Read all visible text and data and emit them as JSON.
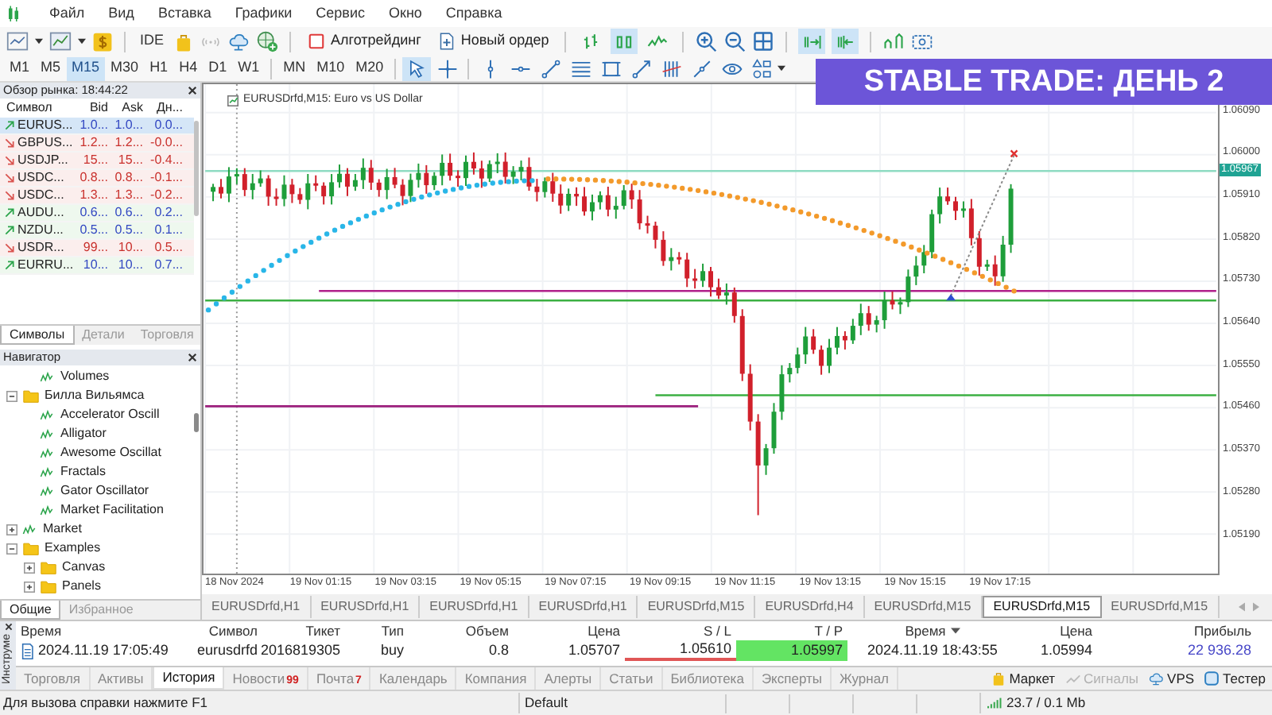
{
  "menu": {
    "items": [
      "Файл",
      "Вид",
      "Вставка",
      "Графики",
      "Сервис",
      "Окно",
      "Справка"
    ]
  },
  "toolbar": {
    "ide_label": "IDE",
    "algotrading_label": "Алготрейдинг",
    "new_order_label": "Новый ордер",
    "chart_modes": [
      {
        "selected": false
      },
      {
        "selected": true
      },
      {
        "selected": false
      }
    ],
    "scroll_modes": [
      {
        "selected": true
      },
      {
        "selected": true
      }
    ]
  },
  "timeframes": [
    {
      "label": "M1",
      "selected": false
    },
    {
      "label": "M5",
      "selected": false
    },
    {
      "label": "M15",
      "selected": true
    },
    {
      "label": "M30",
      "selected": false
    },
    {
      "label": "H1",
      "selected": false
    },
    {
      "label": "H4",
      "selected": false
    },
    {
      "label": "D1",
      "selected": false
    },
    {
      "label": "W1",
      "selected": false
    },
    {
      "label": "MN",
      "selected": false
    },
    {
      "label": "M10",
      "selected": false
    },
    {
      "label": "M20",
      "selected": false
    }
  ],
  "drawing_tools": [
    {
      "selected": true
    },
    {
      "selected": false
    },
    {
      "selected": false
    },
    {
      "selected": false
    },
    {
      "selected": false
    },
    {
      "selected": false
    },
    {
      "selected": false
    },
    {
      "selected": false
    },
    {
      "selected": false
    },
    {
      "selected": false
    },
    {
      "selected": false
    },
    {
      "selected": false
    }
  ],
  "banner": {
    "text": "STABLE TRADE: **ДЕНЬ 2**"
  },
  "market_watch": {
    "title": "Обзор рынка: 18:44:22",
    "columns": [
      "Символ",
      "Bid",
      "Ask",
      "Дн..."
    ],
    "rows": [
      {
        "symbol": "EURUS...",
        "bid": "1.0...",
        "ask": "1.0...",
        "change": "0.0...",
        "rising": true,
        "selected": true
      },
      {
        "symbol": "GBPUS...",
        "bid": "1.2...",
        "ask": "1.2...",
        "change": "-0.0...",
        "rising": false,
        "selected": false
      },
      {
        "symbol": "USDJP...",
        "bid": "15...",
        "ask": "15...",
        "change": "-0.4...",
        "rising": false,
        "selected": false
      },
      {
        "symbol": "USDC...",
        "bid": "0.8...",
        "ask": "0.8...",
        "change": "-0.1...",
        "rising": false,
        "selected": false
      },
      {
        "symbol": "USDC...",
        "bid": "1.3...",
        "ask": "1.3...",
        "change": "-0.2...",
        "rising": false,
        "selected": false
      },
      {
        "symbol": "AUDU...",
        "bid": "0.6...",
        "ask": "0.6...",
        "change": "0.2...",
        "rising": true,
        "selected": false
      },
      {
        "symbol": "NZDU...",
        "bid": "0.5...",
        "ask": "0.5...",
        "change": "0.1...",
        "rising": true,
        "selected": false
      },
      {
        "symbol": "USDR...",
        "bid": "99...",
        "ask": "10...",
        "change": "0.5...",
        "rising": false,
        "selected": false
      },
      {
        "symbol": "EURRU...",
        "bid": "10...",
        "ask": "10...",
        "change": "0.7...",
        "rising": true,
        "selected": false
      }
    ],
    "tabs": [
      {
        "label": "Символы",
        "selected": true
      },
      {
        "label": "Детали",
        "selected": false
      },
      {
        "label": "Торговля",
        "selected": false
      }
    ]
  },
  "navigator": {
    "title": "Навигатор",
    "tree": [
      {
        "kind": "scrolled",
        "children": [
          {
            "kind": "indicator",
            "label": "Volumes"
          }
        ]
      },
      {
        "kind": "folder",
        "label": "Билла Вильямса",
        "expanded": true,
        "children": [
          {
            "kind": "indicator",
            "label": "Accelerator Oscill"
          },
          {
            "kind": "indicator",
            "label": "Alligator"
          },
          {
            "kind": "indicator",
            "label": "Awesome Oscillat"
          },
          {
            "kind": "indicator",
            "label": "Fractals"
          },
          {
            "kind": "indicator",
            "label": "Gator Oscillator"
          },
          {
            "kind": "indicator",
            "label": "Market Facilitation"
          }
        ]
      },
      {
        "kind": "indicator",
        "label": "Market",
        "expanded": false
      },
      {
        "kind": "folder",
        "label": "Examples",
        "expanded": true,
        "children": [
          {
            "kind": "folder",
            "label": "Canvas",
            "expanded": false
          },
          {
            "kind": "folder",
            "label": "Panels",
            "expanded": false
          }
        ]
      }
    ],
    "tabs": [
      {
        "label": "Общие",
        "selected": true
      },
      {
        "label": "Избранное",
        "selected": false
      }
    ]
  },
  "chart": {
    "title": "EURUSDrfd,M15:  Euro vs US Dollar",
    "current_price": "1.05967",
    "price_labels": [
      "1.06090",
      "1.06000",
      "1.05910",
      "1.05820",
      "1.05730",
      "1.05640",
      "1.05550",
      "1.05460",
      "1.05370",
      "1.05280",
      "1.05190"
    ],
    "time_labels": [
      "18 Nov 2024",
      "19 Nov 01:15",
      "19 Nov 03:15",
      "19 Nov 05:15",
      "19 Nov 07:15",
      "19 Nov 09:15",
      "19 Nov 11:15",
      "19 Nov 13:15",
      "19 Nov 15:15",
      "19 Nov 17:15"
    ]
  },
  "chart_tabs": [
    {
      "label": "EURUSDrfd,H1",
      "selected": false
    },
    {
      "label": "EURUSDrfd,H1",
      "selected": false
    },
    {
      "label": "EURUSDrfd,H1",
      "selected": false
    },
    {
      "label": "EURUSDrfd,H1",
      "selected": false
    },
    {
      "label": "EURUSDrfd,M15",
      "selected": false
    },
    {
      "label": "EURUSDrfd,H4",
      "selected": false
    },
    {
      "label": "EURUSDrfd,M15",
      "selected": false
    },
    {
      "label": "EURUSDrfd,M15",
      "selected": true
    },
    {
      "label": "EURUSDrfd,M15",
      "selected": false
    }
  ],
  "toolbox": {
    "side_label": "Инструме",
    "columns": [
      {
        "label": "Время",
        "sorted": false
      },
      {
        "label": "Символ",
        "sorted": false
      },
      {
        "label": "Тикет",
        "sorted": false
      },
      {
        "label": "Тип",
        "sorted": false
      },
      {
        "label": "Объем",
        "sorted": false
      },
      {
        "label": "Цена",
        "sorted": false
      },
      {
        "label": "S / L",
        "sorted": false
      },
      {
        "label": "T / P",
        "sorted": false
      },
      {
        "label": "Время",
        "sorted": true
      },
      {
        "label": "Цена",
        "sorted": false
      },
      {
        "label": "Прибыль",
        "sorted": false
      }
    ],
    "rows": [
      {
        "cells": [
          {
            "text": "2024.11.19 17:05:49",
            "kind": "plain"
          },
          {
            "text": "eurusdrfd",
            "kind": "plain"
          },
          {
            "text": "2016819305",
            "kind": "plain"
          },
          {
            "text": "buy",
            "kind": "plain"
          },
          {
            "text": "0.8",
            "kind": "plain"
          },
          {
            "text": "1.05707",
            "kind": "plain"
          },
          {
            "text": "1.05610",
            "kind": "sl"
          },
          {
            "text": "1.05997",
            "kind": "tp"
          },
          {
            "text": "2024.11.19 18:43:55",
            "kind": "plain"
          },
          {
            "text": "1.05994",
            "kind": "plain"
          },
          {
            "text": "22 936.28",
            "kind": "profit"
          }
        ]
      }
    ],
    "tabs": [
      {
        "label": "Торговля",
        "selected": false
      },
      {
        "label": "Активы",
        "selected": false
      },
      {
        "label": "История",
        "selected": true
      },
      {
        "label": "Новости",
        "selected": false,
        "badge": "99"
      },
      {
        "label": "Почта",
        "selected": false,
        "badge": "7"
      },
      {
        "label": "Календарь",
        "selected": false
      },
      {
        "label": "Компания",
        "selected": false
      },
      {
        "label": "Алерты",
        "selected": false
      },
      {
        "label": "Статьи",
        "selected": false
      },
      {
        "label": "Библиотека",
        "selected": false
      },
      {
        "label": "Эксперты",
        "selected": false
      },
      {
        "label": "Журнал",
        "selected": false
      }
    ],
    "services": [
      {
        "label": "Маркет",
        "disabled": false
      },
      {
        "label": "Сигналы",
        "disabled": true
      },
      {
        "label": "VPS",
        "disabled": false
      },
      {
        "label": "Тестер",
        "disabled": false
      }
    ]
  },
  "status_bar": {
    "help": "Для вызова справки нажмите F1",
    "profile": "Default",
    "connection": "23.7 / 0.1 Mb"
  }
}
